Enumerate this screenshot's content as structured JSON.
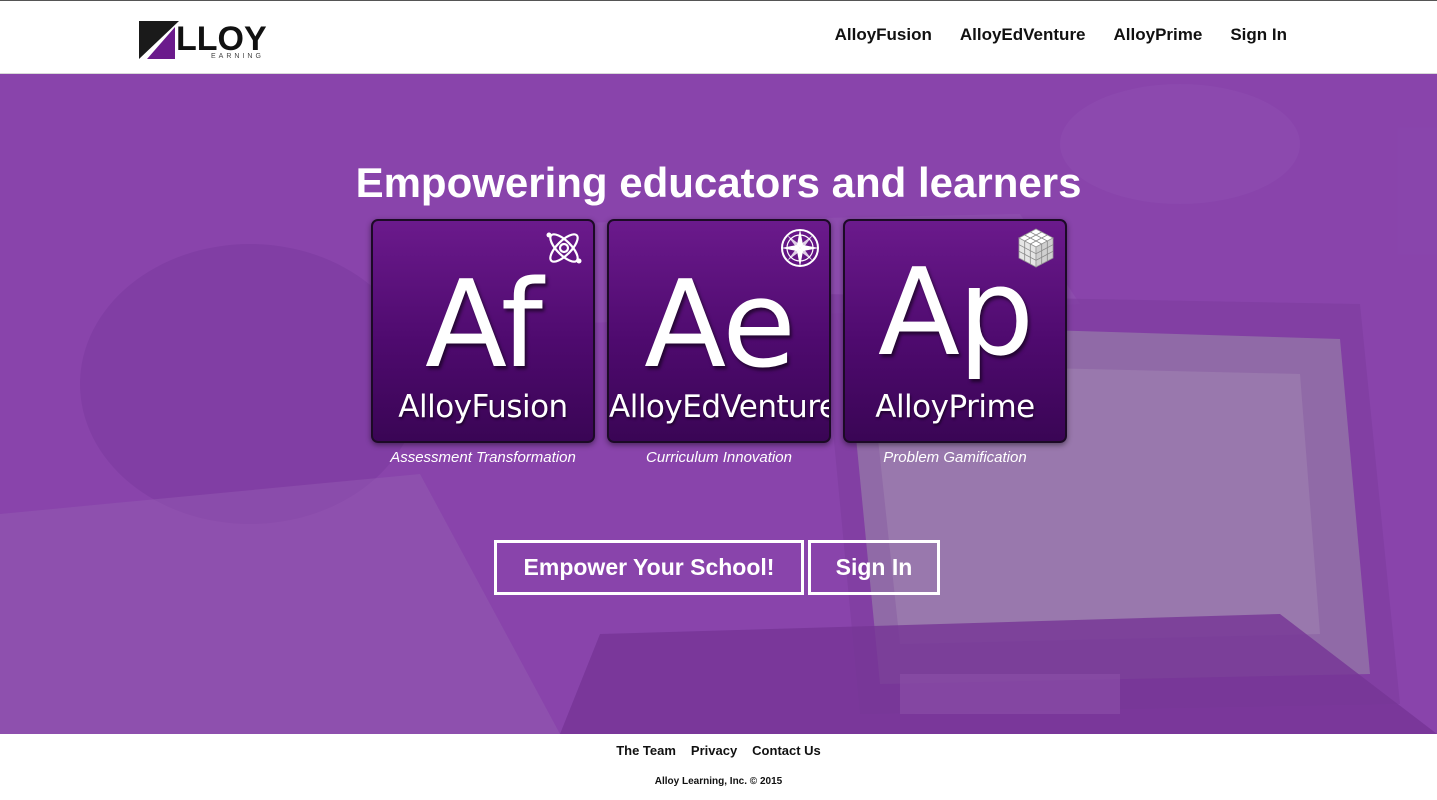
{
  "brand": {
    "logo_text": "LLOY",
    "logo_sub": "EARNING",
    "brand_color": "#6b1a8c"
  },
  "nav": {
    "items": [
      {
        "label": "AlloyFusion"
      },
      {
        "label": "AlloyEdVenture"
      },
      {
        "label": "AlloyPrime"
      },
      {
        "label": "Sign In"
      }
    ]
  },
  "hero": {
    "headline": "Empowering educators and learners",
    "overlay_color": "#8646a8",
    "tiles": [
      {
        "symbol": "Af",
        "name": "AlloyFusion",
        "caption": "Assessment Transformation",
        "icon": "atom-icon"
      },
      {
        "symbol": "Ae",
        "name": "AlloyEdVenture",
        "caption": "Curriculum Innovation",
        "icon": "compass-icon"
      },
      {
        "symbol": "Ap",
        "name": "AlloyPrime",
        "caption": "Problem Gamification",
        "icon": "cube-icon"
      }
    ],
    "cta": {
      "primary_label": "Empower Your School!",
      "secondary_label": "Sign In"
    }
  },
  "footer": {
    "links": [
      {
        "label": "The Team"
      },
      {
        "label": "Privacy"
      },
      {
        "label": "Contact Us"
      }
    ],
    "copyright": "Alloy Learning, Inc. © 2015"
  }
}
